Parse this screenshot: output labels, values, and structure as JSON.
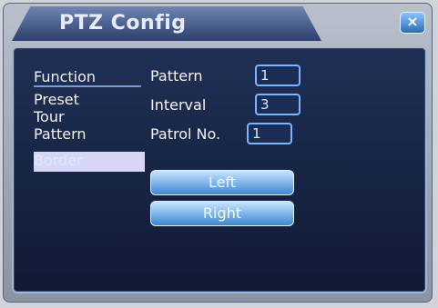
{
  "window": {
    "title": "PTZ Config",
    "close_icon": "close-icon"
  },
  "menu": {
    "items": [
      "Function",
      "Preset",
      "Tour",
      "Pattern",
      "Border"
    ],
    "selected_index": 4
  },
  "form": {
    "pattern_label": "Pattern",
    "pattern_value": "1",
    "interval_label": "Interval",
    "interval_value": "3",
    "patrol_label": "Patrol No.",
    "patrol_value": "1"
  },
  "buttons": {
    "left_label": "Left",
    "right_label": "Right"
  }
}
